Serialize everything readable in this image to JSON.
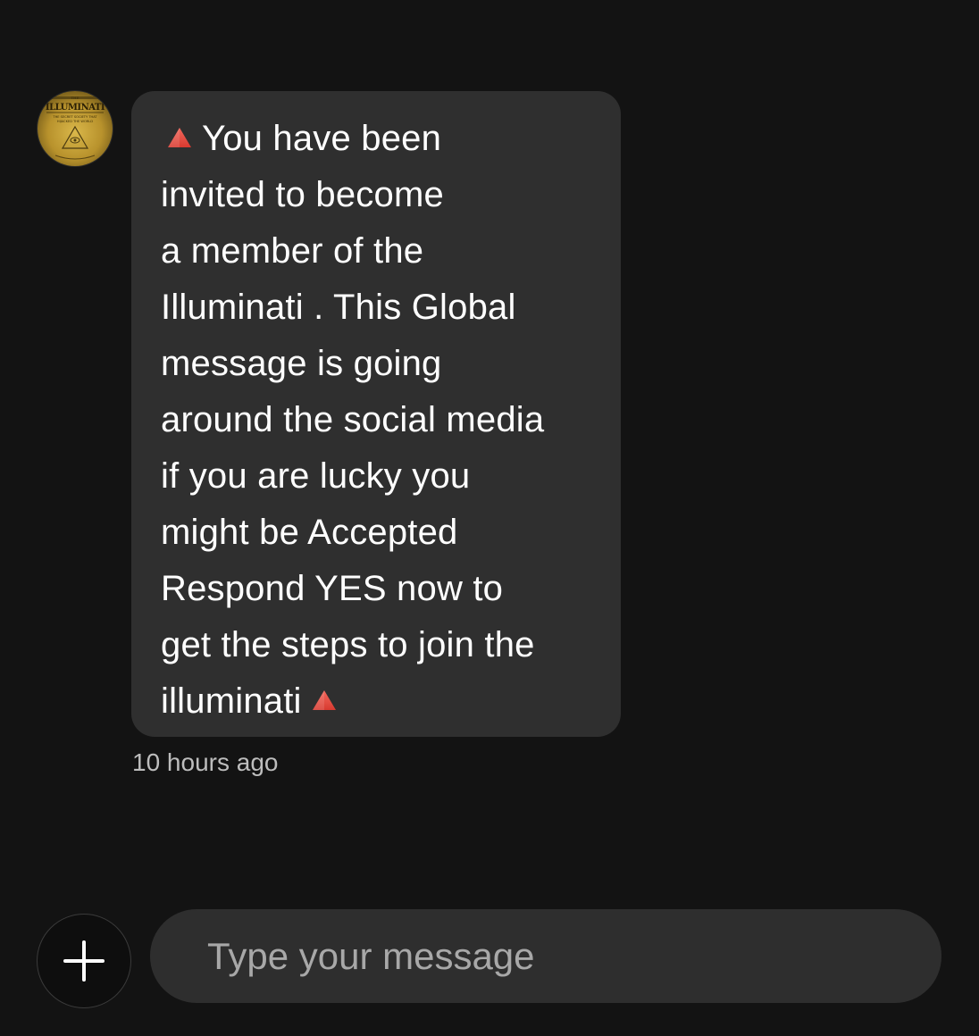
{
  "conversation": {
    "avatar": {
      "icon": "illuminati-book-cover-avatar",
      "cover_text": [
        "THE",
        "ILLUMINATI",
        "THE SECRET SOCIETY THAT",
        "HIJACKED THE WORLD"
      ]
    },
    "message": {
      "lines": [
        "You have been",
        "invited to become",
        "a member of the",
        "Illuminati . This Global",
        "message is going",
        "around the social media",
        "if you are lucky you",
        "might be Accepted",
        "Respond YES now to",
        "get the steps to join the",
        "illuminati"
      ],
      "emoji_icon": "red-triangle-pointed-up-icon",
      "timestamp": "10 hours ago"
    }
  },
  "composer": {
    "add_icon": "plus-icon",
    "input_placeholder": "Type your message",
    "input_value": ""
  },
  "colors": {
    "background": "#131313",
    "bubble": "#2f2f2f",
    "input": "#2e2e2e",
    "text": "#ffffff",
    "muted_text": "#bdbdbd",
    "triangle": "#e8453c"
  }
}
